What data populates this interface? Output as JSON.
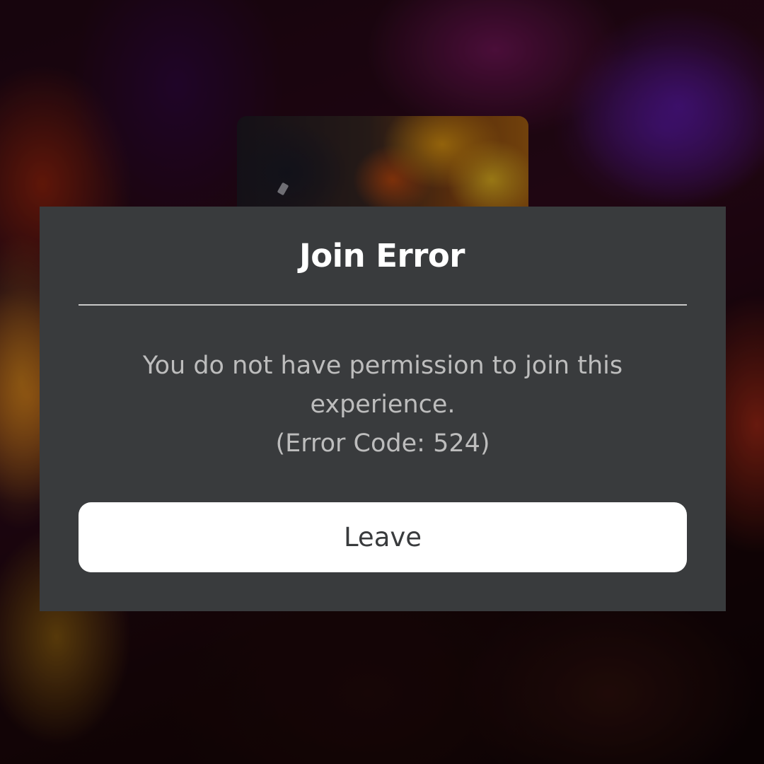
{
  "dialog": {
    "title": "Join Error",
    "message_line1": "You do not have permission to join this",
    "message_line2": "experience.",
    "error_code": "(Error Code: 524)",
    "leave_label": "Leave"
  },
  "colors": {
    "dialog_background": "#393b3d",
    "title_text": "#ffffff",
    "message_text": "#bdbdbd",
    "divider": "#c8c8c8",
    "button_background": "#ffffff",
    "button_text": "#393b3d"
  }
}
